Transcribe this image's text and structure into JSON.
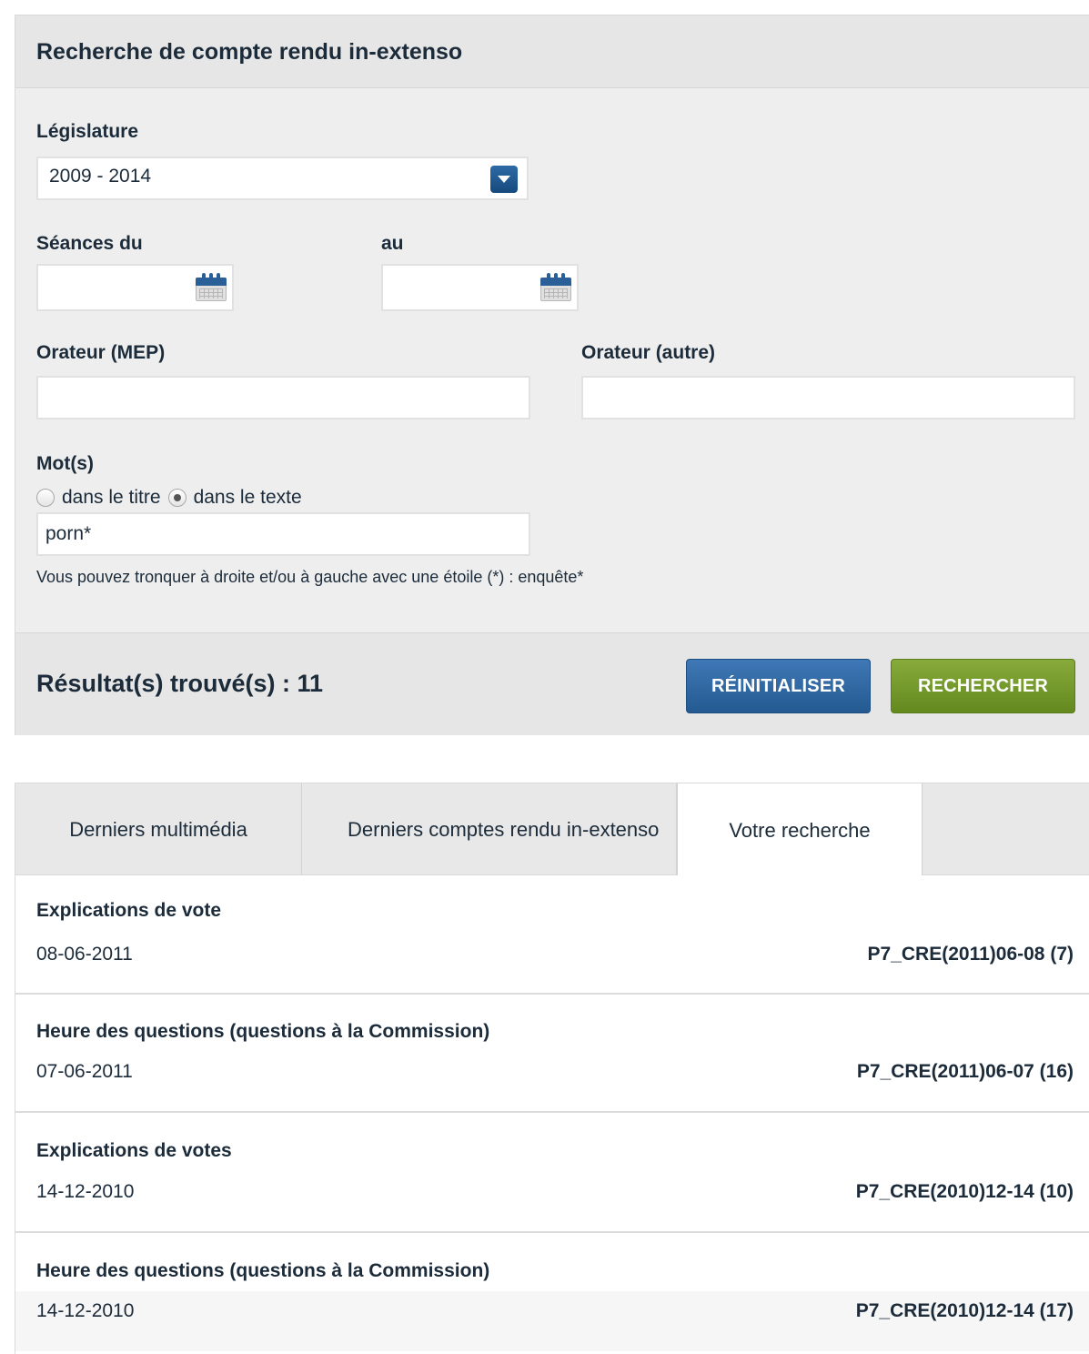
{
  "panel": {
    "title": "Recherche de compte rendu in-extenso"
  },
  "legislature": {
    "label": "Législature",
    "value": "2009 - 2014"
  },
  "dates": {
    "from_label": "Séances du",
    "to_label": "au",
    "from_value": "",
    "to_value": ""
  },
  "speakers": {
    "mep_label": "Orateur (MEP)",
    "other_label": "Orateur (autre)",
    "mep_value": "",
    "other_value": ""
  },
  "words": {
    "label": "Mot(s)",
    "option_title": "dans le titre",
    "option_text": "dans le texte",
    "selected": "dans le texte",
    "value": "porn*",
    "hint": "Vous pouvez tronquer à droite et/ou à gauche avec une étoile (*) : enquête*"
  },
  "footer": {
    "result_text": "Résultat(s) trouvé(s) : 11",
    "reset_label": "RÉINITIALISER",
    "search_label": "RECHERCHER"
  },
  "colors": {
    "reset_button": "#2f6aa6",
    "search_button": "#76982b",
    "panel_bg": "#eeeeee",
    "text": "#1c2b3a"
  },
  "tabs": [
    {
      "label": "Derniers multimédia"
    },
    {
      "label": "Derniers comptes rendu in-extenso"
    },
    {
      "label": "Votre recherche",
      "active": true
    }
  ],
  "results": [
    {
      "title": "Explications de vote",
      "date": "08-06-2011",
      "ref": "P7_CRE(2011)06-08 (7)"
    },
    {
      "title": "Heure des questions (questions à la Commission)",
      "date": "07-06-2011",
      "ref": "P7_CRE(2011)06-07 (16)"
    },
    {
      "title": "Explications de votes",
      "date": "14-12-2010",
      "ref": "P7_CRE(2010)12-14 (10)"
    },
    {
      "title": "Heure des questions (questions à la Commission)",
      "date": "14-12-2010",
      "ref": "P7_CRE(2010)12-14 (17)"
    }
  ],
  "icons": {
    "select": "chevron-down-icon",
    "date": "calendar-icon"
  }
}
